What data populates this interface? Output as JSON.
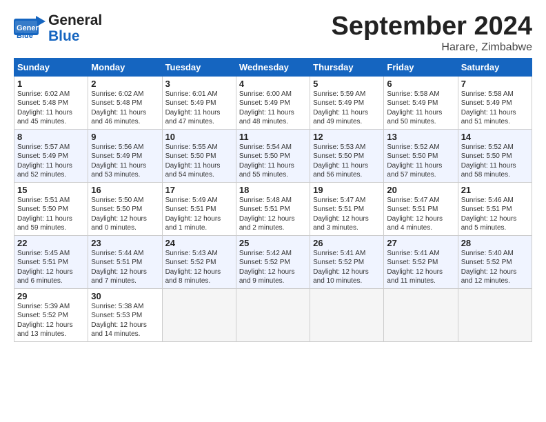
{
  "header": {
    "logo_general": "General",
    "logo_blue": "Blue",
    "month_title": "September 2024",
    "subtitle": "Harare, Zimbabwe"
  },
  "columns": [
    "Sunday",
    "Monday",
    "Tuesday",
    "Wednesday",
    "Thursday",
    "Friday",
    "Saturday"
  ],
  "weeks": [
    [
      {
        "day": "1",
        "lines": [
          "Sunrise: 6:02 AM",
          "Sunset: 5:48 PM",
          "Daylight: 11 hours",
          "and 45 minutes."
        ]
      },
      {
        "day": "2",
        "lines": [
          "Sunrise: 6:02 AM",
          "Sunset: 5:48 PM",
          "Daylight: 11 hours",
          "and 46 minutes."
        ]
      },
      {
        "day": "3",
        "lines": [
          "Sunrise: 6:01 AM",
          "Sunset: 5:49 PM",
          "Daylight: 11 hours",
          "and 47 minutes."
        ]
      },
      {
        "day": "4",
        "lines": [
          "Sunrise: 6:00 AM",
          "Sunset: 5:49 PM",
          "Daylight: 11 hours",
          "and 48 minutes."
        ]
      },
      {
        "day": "5",
        "lines": [
          "Sunrise: 5:59 AM",
          "Sunset: 5:49 PM",
          "Daylight: 11 hours",
          "and 49 minutes."
        ]
      },
      {
        "day": "6",
        "lines": [
          "Sunrise: 5:58 AM",
          "Sunset: 5:49 PM",
          "Daylight: 11 hours",
          "and 50 minutes."
        ]
      },
      {
        "day": "7",
        "lines": [
          "Sunrise: 5:58 AM",
          "Sunset: 5:49 PM",
          "Daylight: 11 hours",
          "and 51 minutes."
        ]
      }
    ],
    [
      {
        "day": "8",
        "lines": [
          "Sunrise: 5:57 AM",
          "Sunset: 5:49 PM",
          "Daylight: 11 hours",
          "and 52 minutes."
        ]
      },
      {
        "day": "9",
        "lines": [
          "Sunrise: 5:56 AM",
          "Sunset: 5:49 PM",
          "Daylight: 11 hours",
          "and 53 minutes."
        ]
      },
      {
        "day": "10",
        "lines": [
          "Sunrise: 5:55 AM",
          "Sunset: 5:50 PM",
          "Daylight: 11 hours",
          "and 54 minutes."
        ]
      },
      {
        "day": "11",
        "lines": [
          "Sunrise: 5:54 AM",
          "Sunset: 5:50 PM",
          "Daylight: 11 hours",
          "and 55 minutes."
        ]
      },
      {
        "day": "12",
        "lines": [
          "Sunrise: 5:53 AM",
          "Sunset: 5:50 PM",
          "Daylight: 11 hours",
          "and 56 minutes."
        ]
      },
      {
        "day": "13",
        "lines": [
          "Sunrise: 5:52 AM",
          "Sunset: 5:50 PM",
          "Daylight: 11 hours",
          "and 57 minutes."
        ]
      },
      {
        "day": "14",
        "lines": [
          "Sunrise: 5:52 AM",
          "Sunset: 5:50 PM",
          "Daylight: 11 hours",
          "and 58 minutes."
        ]
      }
    ],
    [
      {
        "day": "15",
        "lines": [
          "Sunrise: 5:51 AM",
          "Sunset: 5:50 PM",
          "Daylight: 11 hours",
          "and 59 minutes."
        ]
      },
      {
        "day": "16",
        "lines": [
          "Sunrise: 5:50 AM",
          "Sunset: 5:50 PM",
          "Daylight: 12 hours",
          "and 0 minutes."
        ]
      },
      {
        "day": "17",
        "lines": [
          "Sunrise: 5:49 AM",
          "Sunset: 5:51 PM",
          "Daylight: 12 hours",
          "and 1 minute."
        ]
      },
      {
        "day": "18",
        "lines": [
          "Sunrise: 5:48 AM",
          "Sunset: 5:51 PM",
          "Daylight: 12 hours",
          "and 2 minutes."
        ]
      },
      {
        "day": "19",
        "lines": [
          "Sunrise: 5:47 AM",
          "Sunset: 5:51 PM",
          "Daylight: 12 hours",
          "and 3 minutes."
        ]
      },
      {
        "day": "20",
        "lines": [
          "Sunrise: 5:47 AM",
          "Sunset: 5:51 PM",
          "Daylight: 12 hours",
          "and 4 minutes."
        ]
      },
      {
        "day": "21",
        "lines": [
          "Sunrise: 5:46 AM",
          "Sunset: 5:51 PM",
          "Daylight: 12 hours",
          "and 5 minutes."
        ]
      }
    ],
    [
      {
        "day": "22",
        "lines": [
          "Sunrise: 5:45 AM",
          "Sunset: 5:51 PM",
          "Daylight: 12 hours",
          "and 6 minutes."
        ]
      },
      {
        "day": "23",
        "lines": [
          "Sunrise: 5:44 AM",
          "Sunset: 5:51 PM",
          "Daylight: 12 hours",
          "and 7 minutes."
        ]
      },
      {
        "day": "24",
        "lines": [
          "Sunrise: 5:43 AM",
          "Sunset: 5:52 PM",
          "Daylight: 12 hours",
          "and 8 minutes."
        ]
      },
      {
        "day": "25",
        "lines": [
          "Sunrise: 5:42 AM",
          "Sunset: 5:52 PM",
          "Daylight: 12 hours",
          "and 9 minutes."
        ]
      },
      {
        "day": "26",
        "lines": [
          "Sunrise: 5:41 AM",
          "Sunset: 5:52 PM",
          "Daylight: 12 hours",
          "and 10 minutes."
        ]
      },
      {
        "day": "27",
        "lines": [
          "Sunrise: 5:41 AM",
          "Sunset: 5:52 PM",
          "Daylight: 12 hours",
          "and 11 minutes."
        ]
      },
      {
        "day": "28",
        "lines": [
          "Sunrise: 5:40 AM",
          "Sunset: 5:52 PM",
          "Daylight: 12 hours",
          "and 12 minutes."
        ]
      }
    ],
    [
      {
        "day": "29",
        "lines": [
          "Sunrise: 5:39 AM",
          "Sunset: 5:52 PM",
          "Daylight: 12 hours",
          "and 13 minutes."
        ]
      },
      {
        "day": "30",
        "lines": [
          "Sunrise: 5:38 AM",
          "Sunset: 5:53 PM",
          "Daylight: 12 hours",
          "and 14 minutes."
        ]
      },
      null,
      null,
      null,
      null,
      null
    ]
  ]
}
